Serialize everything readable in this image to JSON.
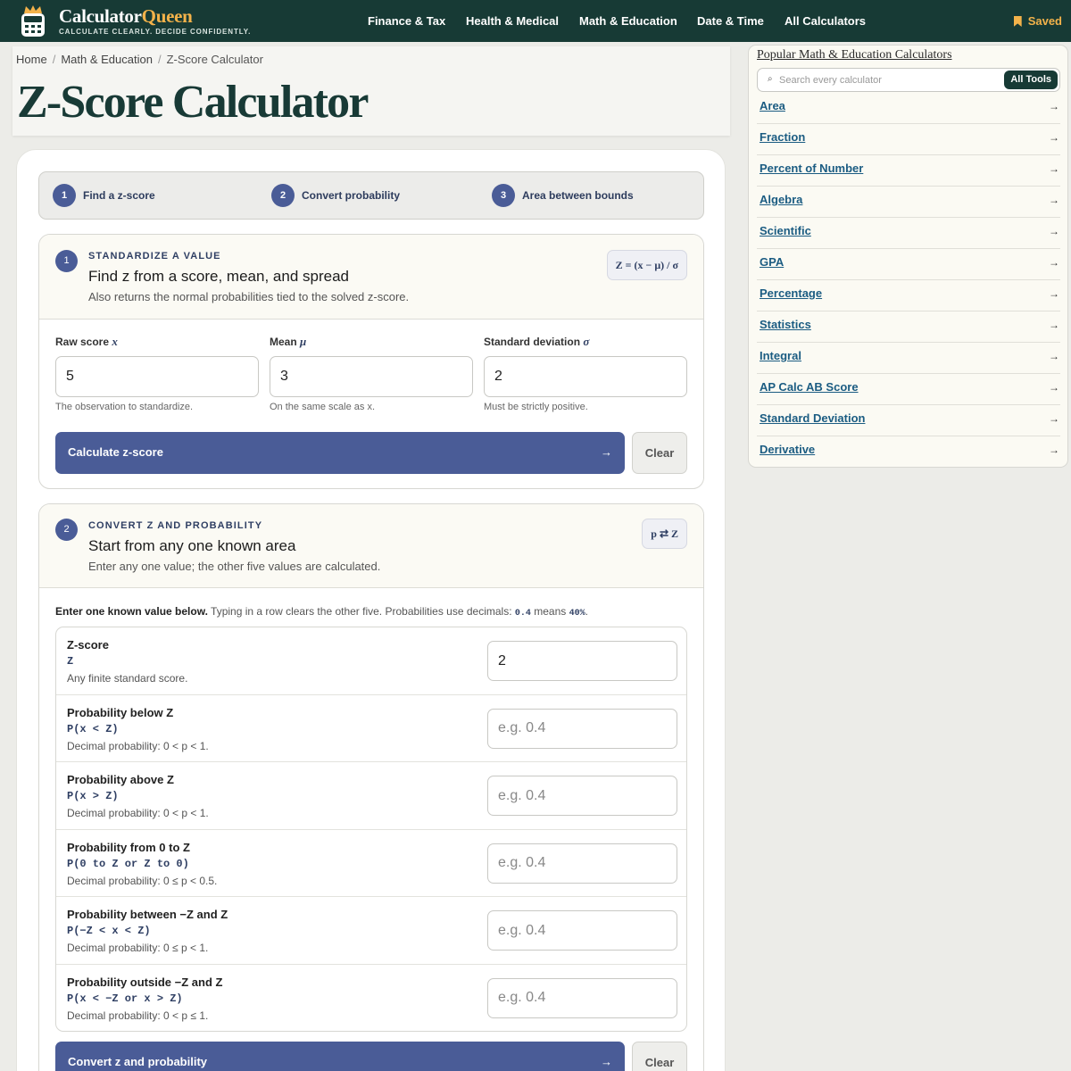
{
  "header": {
    "brand_main": "Calculator",
    "brand_accent": "Queen",
    "tagline": "CALCULATE CLEARLY. DECIDE CONFIDENTLY.",
    "nav": [
      "Finance & Tax",
      "Health & Medical",
      "Math & Education",
      "Date & Time",
      "All Calculators"
    ],
    "saved_label": "Saved",
    "colors": {
      "bar": "#173a35",
      "accent": "#f3b24a"
    }
  },
  "breadcrumb": [
    "Home",
    "Math & Education",
    "Z-Score Calculator"
  ],
  "page_title": "Z-Score Calculator",
  "steps": [
    {
      "num": "1",
      "label": "Find a z-score"
    },
    {
      "num": "2",
      "label": "Convert probability"
    },
    {
      "num": "3",
      "label": "Area between bounds"
    }
  ],
  "section1": {
    "num": "1",
    "eyebrow": "STANDARDIZE A VALUE",
    "title": "Find z from a score, mean, and spread",
    "desc": "Also returns the normal probabilities tied to the solved z-score.",
    "formula": "Z = (x − μ) / σ",
    "fields": [
      {
        "label": "Raw score",
        "symbol": "x",
        "value": "5",
        "hint": "The observation to standardize."
      },
      {
        "label": "Mean",
        "symbol": "μ",
        "value": "3",
        "hint": "On the same scale as x."
      },
      {
        "label": "Standard deviation",
        "symbol": "σ",
        "value": "2",
        "hint": "Must be strictly positive."
      }
    ],
    "submit_label": "Calculate z-score",
    "submit_arrow": "→",
    "clear_label": "Clear"
  },
  "section2": {
    "num": "2",
    "eyebrow": "CONVERT Z AND PROBABILITY",
    "title": "Start from any one known area",
    "desc": "Enter any one value; the other five values are calculated.",
    "formula": "p ⇄ Z",
    "intro_bold": "Enter one known value below.",
    "intro_text": "Typing in a row clears the other five. Probabilities use decimals:",
    "intro_code1": "0.4",
    "intro_mid": "means",
    "intro_code2": "40%",
    "intro_end": ".",
    "rows": [
      {
        "name": "Z-score",
        "expr": "Z",
        "note": "Any finite standard score.",
        "value": "2",
        "placeholder": ""
      },
      {
        "name": "Probability below Z",
        "expr": "P(x < Z)",
        "note": "Decimal probability: 0 < p < 1.",
        "value": "",
        "placeholder": "e.g. 0.4"
      },
      {
        "name": "Probability above Z",
        "expr": "P(x > Z)",
        "note": "Decimal probability: 0 < p < 1.",
        "value": "",
        "placeholder": "e.g. 0.4"
      },
      {
        "name": "Probability from 0 to Z",
        "expr": "P(0 to Z or Z to 0)",
        "note": "Decimal probability: 0 ≤ p < 0.5.",
        "value": "",
        "placeholder": "e.g. 0.4"
      },
      {
        "name": "Probability between −Z and Z",
        "expr": "P(−Z < x < Z)",
        "note": "Decimal probability: 0 ≤ p < 1.",
        "value": "",
        "placeholder": "e.g. 0.4"
      },
      {
        "name": "Probability outside −Z and Z",
        "expr": "P(x < −Z or x > Z)",
        "note": "Decimal probability: 0 < p ≤ 1.",
        "value": "",
        "placeholder": "e.g. 0.4"
      }
    ],
    "submit_label": "Convert z and probability",
    "submit_arrow": "→",
    "clear_label": "Clear"
  },
  "sidebar": {
    "title": "Popular Math & Education Calculators",
    "search_placeholder": "Search every calculator",
    "all_tools_label": "All Tools",
    "arrow": "→",
    "links": [
      "Area",
      "Fraction",
      "Percent of Number",
      "Algebra",
      "Scientific",
      "GPA",
      "Percentage",
      "Statistics",
      "Integral",
      "AP Calc AB Score",
      "Standard Deviation",
      "Derivative"
    ]
  }
}
